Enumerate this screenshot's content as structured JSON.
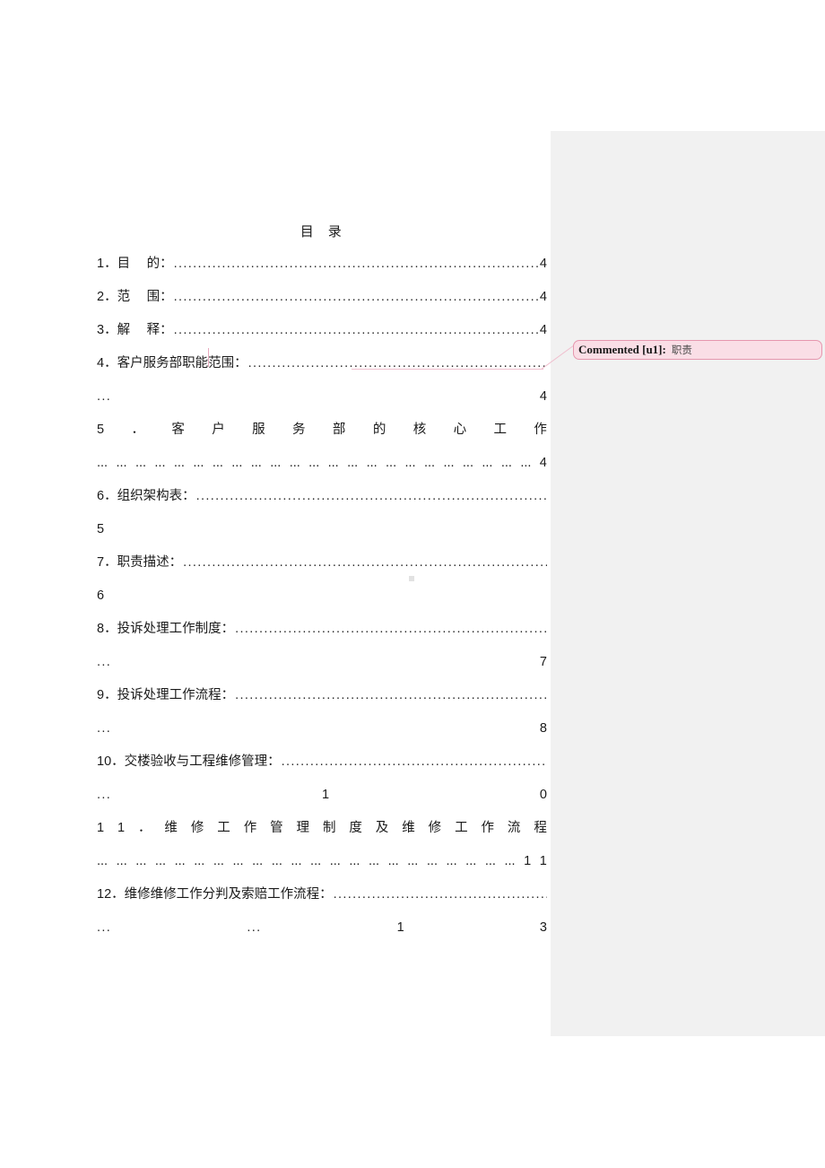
{
  "document": {
    "toc_title": "目　录",
    "entries": [
      {
        "id": "entry-1",
        "label": "1．目　 的：",
        "leader": "........................................................................................................",
        "page": "4",
        "wrapped": false
      },
      {
        "id": "entry-2",
        "label": "2．范　 围：",
        "leader": "........................................................................................................",
        "page": "4",
        "wrapped": false
      },
      {
        "id": "entry-3",
        "label": "3．解　 释：",
        "leader": "........................................................................................................",
        "page": "4",
        "wrapped": false
      },
      {
        "id": "entry-4",
        "label": "4．客户服务部职能范围：",
        "leader": "..............................................................................................",
        "page": "4",
        "wrapped": true,
        "cont_dots": "...",
        "cont_page": "4"
      },
      {
        "id": "entry-5",
        "label": "5．客户服务部的核心工作",
        "spread_chars": [
          "5",
          "．",
          "客",
          "户",
          "服",
          "务",
          "部",
          "的",
          "核",
          "心",
          "工",
          "作"
        ],
        "page": "4",
        "wrapped": true,
        "spread_cont": [
          "...",
          "...",
          "...",
          "...",
          "...",
          "...",
          "...",
          "...",
          "...",
          "...",
          "...",
          "...",
          "...",
          "...",
          "...",
          "...",
          "...",
          "...",
          "...",
          "...",
          "...",
          "...",
          "...",
          "4"
        ]
      },
      {
        "id": "entry-6",
        "label": "6．组织架构表：",
        "leader": "..........................................................................................................",
        "page": "5",
        "wrapped": true,
        "cont_left_page": "5"
      },
      {
        "id": "entry-7",
        "label": "7．职责描述：",
        "leader": "............................................................................................................",
        "page": "6",
        "wrapped": true,
        "cont_left_page": "6"
      },
      {
        "id": "entry-8",
        "label": "8．投诉处理工作制度：",
        "leader": "................................................................................................",
        "page": "7",
        "wrapped": true,
        "cont_dots": "...",
        "cont_page": "7"
      },
      {
        "id": "entry-9",
        "label": "9．投诉处理工作流程：",
        "leader": "................................................................................................",
        "page": "8",
        "wrapped": true,
        "cont_dots": "...",
        "cont_page": "8"
      },
      {
        "id": "entry-10",
        "label": "10．交楼验收与工程维修管理：",
        "leader": "................................................................................",
        "page": "10",
        "wrapped": true,
        "cont_dots": "...",
        "cont_mid": "1",
        "cont_page": "0"
      },
      {
        "id": "entry-11",
        "label": "11．维修工作管理制度及维修工作流程",
        "spread_chars": [
          "1",
          "1",
          "．",
          "维",
          "修",
          "工",
          "作",
          "管",
          "理",
          "制",
          "度",
          "及",
          "维",
          "修",
          "工",
          "作",
          "流",
          "程"
        ],
        "page": "11",
        "wrapped": true,
        "spread_cont": [
          "...",
          "...",
          "...",
          "...",
          "...",
          "...",
          "...",
          "...",
          "...",
          "...",
          "...",
          "...",
          "...",
          "...",
          "...",
          "...",
          "...",
          "...",
          "...",
          "...",
          "...",
          "...",
          "1",
          "1"
        ]
      },
      {
        "id": "entry-12",
        "label": "12．维修维修工作分判及索赔工作流程：",
        "leader": "..................................................................",
        "page": "13",
        "wrapped": true,
        "cont_dots": "...",
        "cont_mid2": "...",
        "cont_mid": "1",
        "cont_page": "3"
      }
    ]
  },
  "comments": {
    "pane_background": "#f1f1f1",
    "balloon_background": "#fadee6",
    "balloon_border": "#e697ae",
    "anchor_color": "#e8a9bd",
    "items": [
      {
        "id": "comment-u1",
        "label": "Commented [u1]:",
        "text": "职责"
      }
    ]
  }
}
